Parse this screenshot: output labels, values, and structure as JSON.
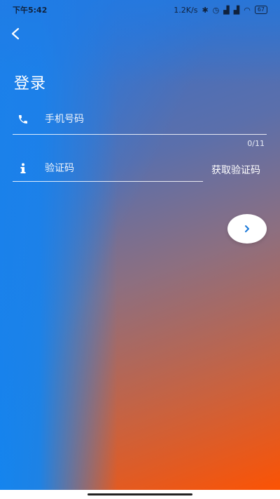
{
  "status_bar": {
    "time": "下午5:42",
    "speed": "1.2K/s",
    "battery": "67"
  },
  "page": {
    "title": "登录"
  },
  "phone_field": {
    "placeholder": "手机号码",
    "counter": "0/11",
    "icon": "phone-icon"
  },
  "code_field": {
    "placeholder": "验证码",
    "icon": "info-icon",
    "get_code_label": "获取验证码"
  },
  "colors": {
    "blue": "#1484ee",
    "orange": "#ff5200",
    "button_arrow": "#1a78d8"
  }
}
